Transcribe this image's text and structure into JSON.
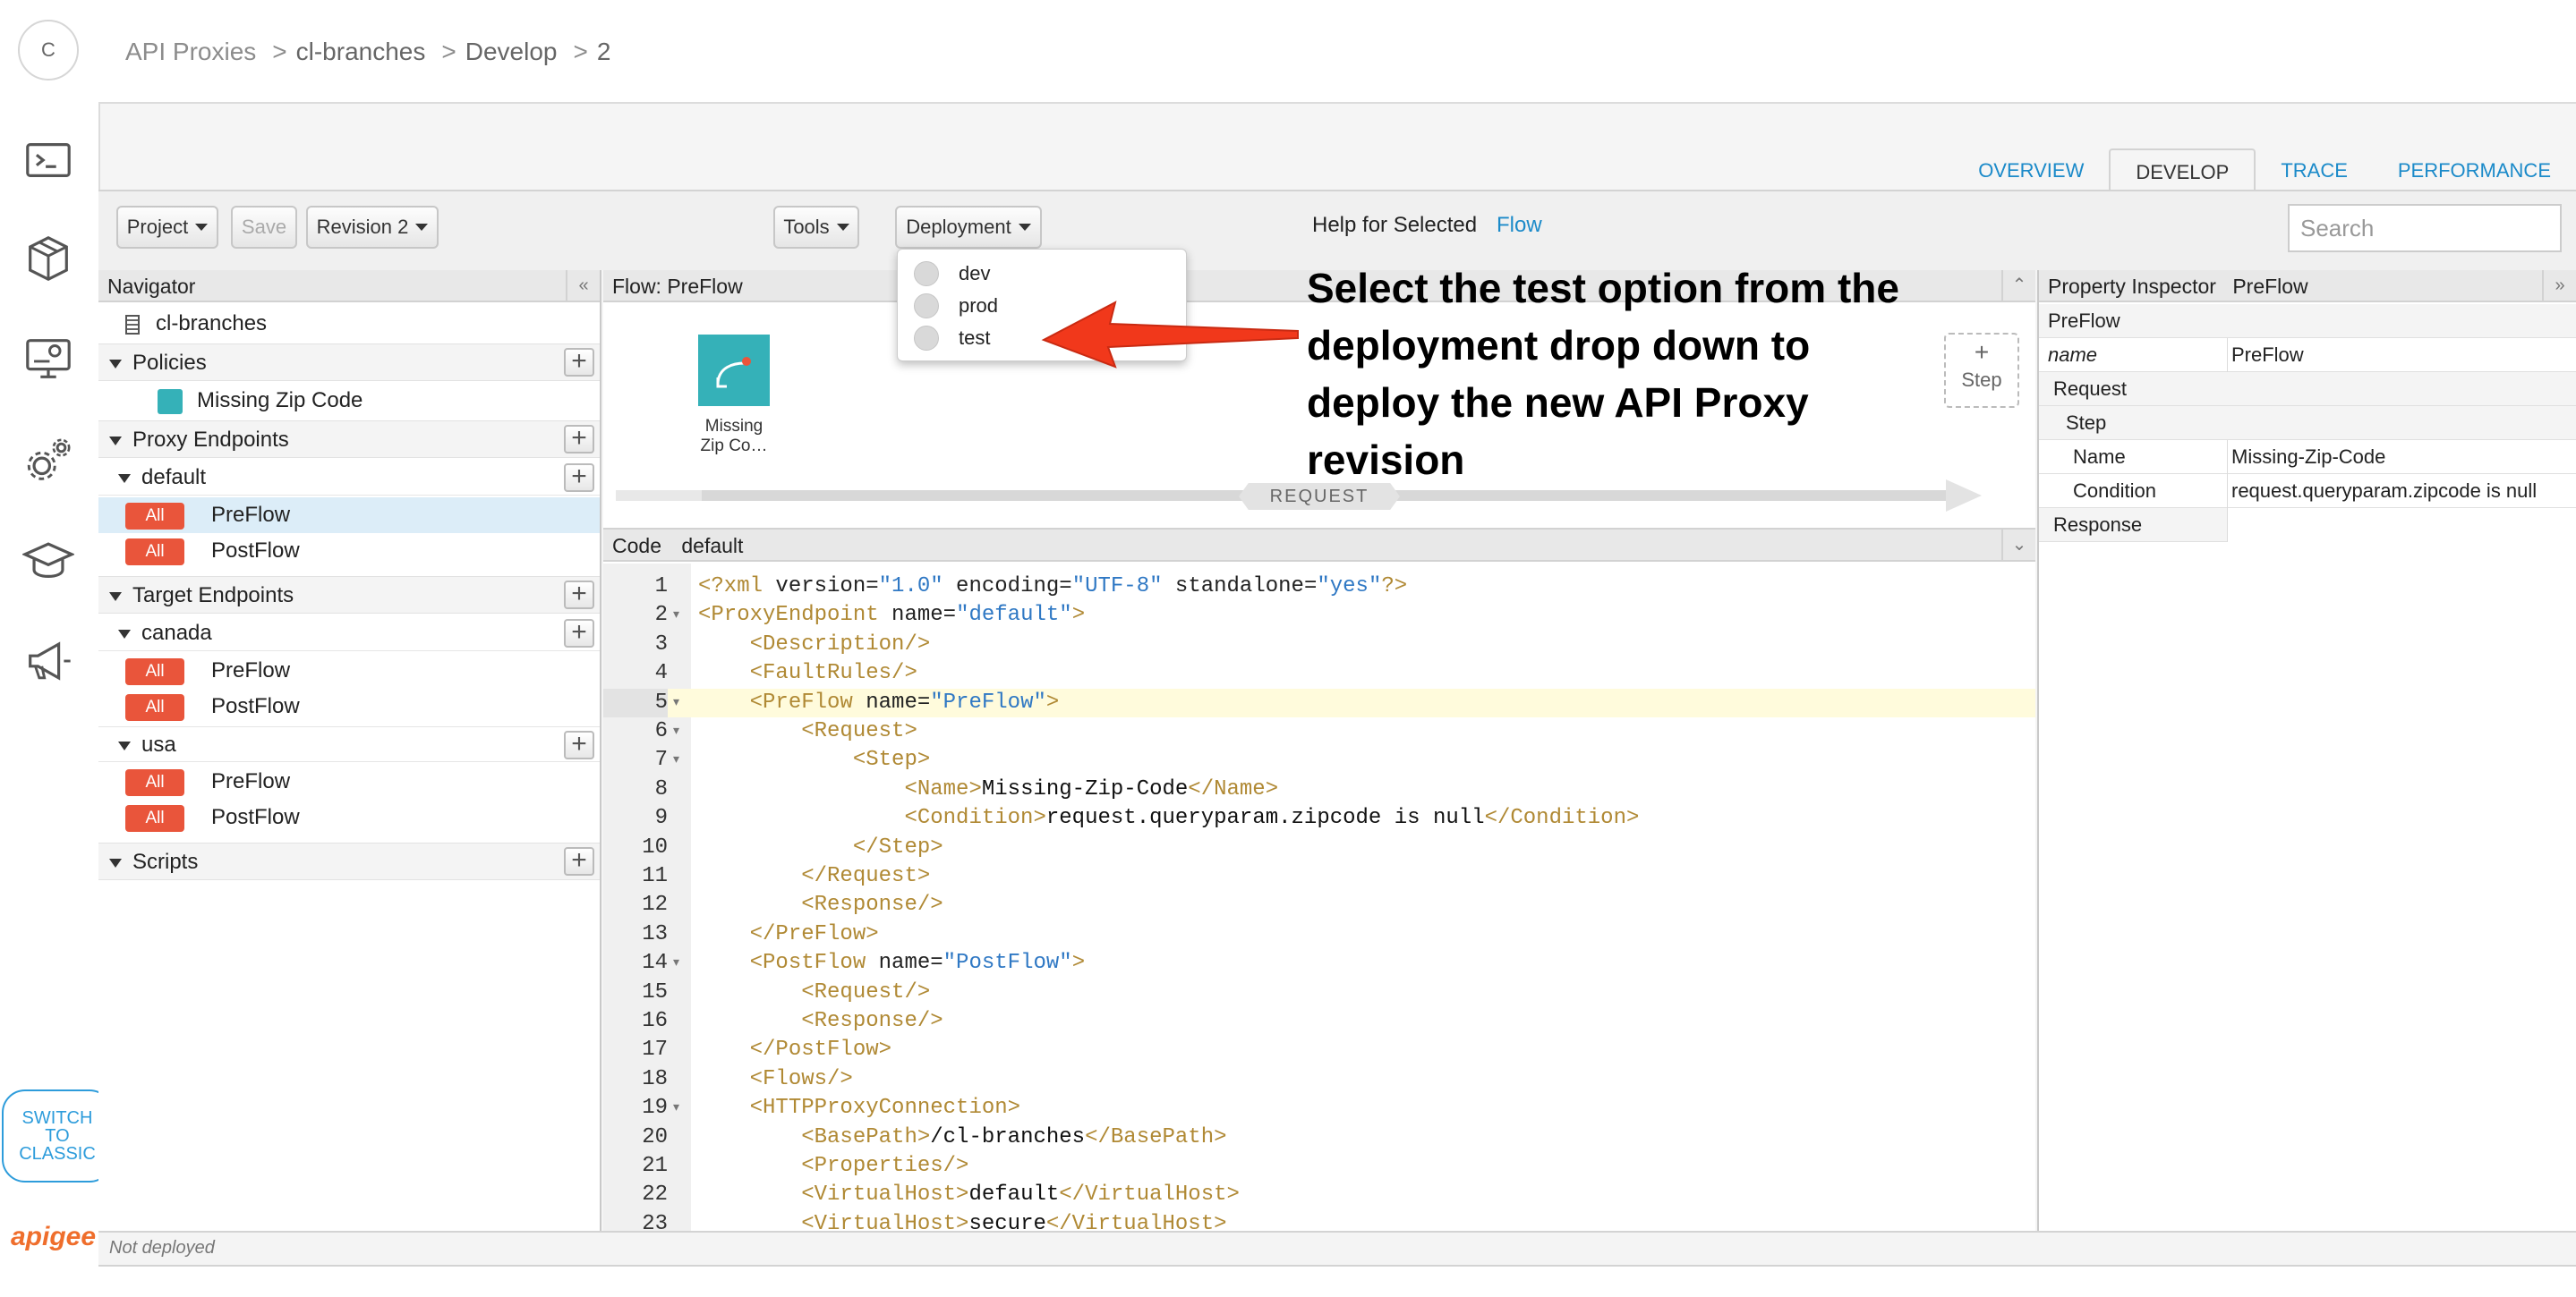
{
  "breadcrumb": {
    "items": [
      "API Proxies",
      "cl-branches",
      "Develop",
      "2"
    ]
  },
  "rail": {
    "avatar_letter": "C",
    "switch_classic": [
      "SWITCH",
      "TO",
      "CLASSIC"
    ],
    "logo": "apigee"
  },
  "tabs": [
    "OVERVIEW",
    "DEVELOP",
    "TRACE",
    "PERFORMANCE"
  ],
  "toolbar": {
    "project": "Project",
    "save": "Save",
    "revision": "Revision 2",
    "tools": "Tools",
    "deployment": "Deployment",
    "help_label": "Help for Selected",
    "help_link": "Flow",
    "search_placeholder": "Search"
  },
  "deployment_menu": [
    "dev",
    "prod",
    "test"
  ],
  "navigator": {
    "title": "Navigator",
    "proxy_name": "cl-branches",
    "policies": "Policies",
    "policy_item": "Missing Zip Code",
    "proxy_endpoints": "Proxy Endpoints",
    "default_endpoint": "default",
    "target_endpoints": "Target Endpoints",
    "canada": "canada",
    "usa": "usa",
    "scripts": "Scripts",
    "badge": "All",
    "preflow": "PreFlow",
    "postflow": "PostFlow"
  },
  "flow": {
    "title": "Flow: PreFlow",
    "policy_label_1": "Missing",
    "policy_label_2": "Zip Co…",
    "step_plus": "+",
    "step_label": "Step",
    "request_label": "REQUEST"
  },
  "code": {
    "title": "Code",
    "endpoint": "default"
  },
  "inspector": {
    "title": "Property Inspector",
    "subject": "PreFlow",
    "rows": {
      "preflow": "PreFlow",
      "name_key": "name",
      "name_val": "PreFlow",
      "request": "Request",
      "step": "Step",
      "step_name_key": "Name",
      "step_name_val": "Missing-Zip-Code",
      "condition_key": "Condition",
      "condition_val": "request.queryparam.zipcode is null",
      "response": "Response"
    }
  },
  "annotation": "Select the test option from the deployment drop down to deploy the new API Proxy revision",
  "status": "Not deployed",
  "colors": {
    "accent_blue": "#1b8ac9",
    "badge_red": "#e9553b",
    "policy_teal": "#35b1b8",
    "arrow_red": "#f1381b"
  }
}
